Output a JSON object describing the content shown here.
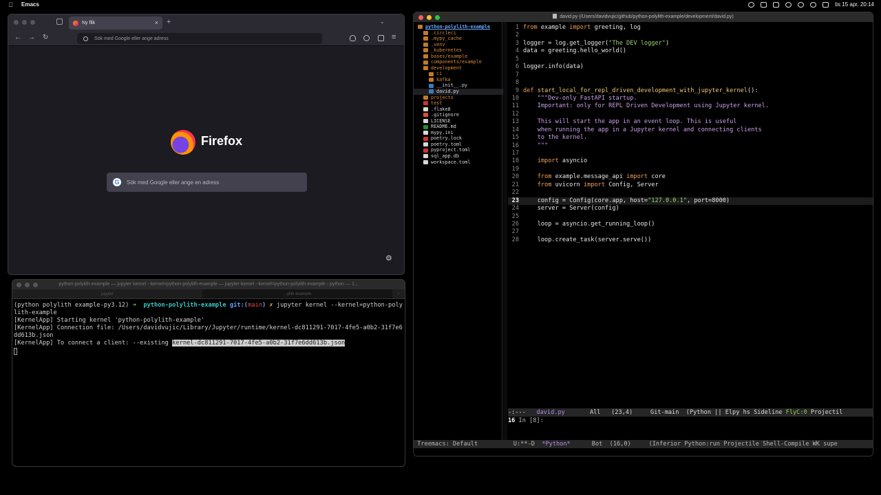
{
  "menubar": {
    "app_name": "Emacs",
    "datetime": "tis 15 apr. 20:14"
  },
  "firefox": {
    "tab_title": "Ny flik",
    "url_placeholder": "Sök med Google eller ange adress",
    "brand": "Firefox",
    "search_placeholder": "Sök med Google eller ange en adress"
  },
  "terminal": {
    "title": "python-polylith-example — jupyter kernel --kernel=python-polylith-example — jupyter-kernel --kernel=python-polylith-example › python — 1...",
    "tabs": [
      "jupyter",
      "...ylith-example"
    ],
    "prompt_env": "(python polylith example-py3.12)",
    "prompt_arrow": "➜",
    "prompt_dir": "python-polylith-example",
    "prompt_git_pre": "git:(",
    "prompt_branch": "main",
    "prompt_git_post": ")",
    "prompt_mark": "✗",
    "command": "jupyter kernel --kernel=python-polylith-example",
    "output_1": "[KernelApp] Starting kernel 'python-polylith-example'",
    "output_2": "[KernelApp] Connection file: /Users/davidvujic/Library/Jupyter/runtime/kernel-dc811291-7017-4fe5-a0b2-31f7e6dd613b.json",
    "output_3_prefix": "[KernelApp] To connect a client: --existing ",
    "output_3_selected": "kernel-dc811291-7017-4fe5-a0b2-31f7e6dd613b.json"
  },
  "emacs": {
    "title": "david.py (/Users/davidvujic/github/python-polylith-example/development/david.py)",
    "tree_root": "python-polylith-example",
    "tree": [
      {
        "name": ".circleci",
        "kind": "dir",
        "indent": 1
      },
      {
        "name": ".mypy_cache",
        "kind": "dir",
        "indent": 1
      },
      {
        "name": ".venv",
        "kind": "dir",
        "indent": 1
      },
      {
        "name": "_kubernetes",
        "kind": "dir",
        "indent": 1
      },
      {
        "name": "bases/example",
        "kind": "dir",
        "indent": 1
      },
      {
        "name": "components/example",
        "kind": "dir",
        "indent": 1
      },
      {
        "name": "development",
        "kind": "dir",
        "indent": 1
      },
      {
        "name": "ci",
        "kind": "dir",
        "indent": 2
      },
      {
        "name": "kafka",
        "kind": "dir",
        "indent": 2
      },
      {
        "name": "__init__.py",
        "kind": "py",
        "indent": 2
      },
      {
        "name": "david.py",
        "kind": "py",
        "indent": 2,
        "selected": true
      },
      {
        "name": "projects",
        "kind": "dir",
        "indent": 1
      },
      {
        "name": "test",
        "kind": "red-dir",
        "indent": 1
      },
      {
        "name": ".flake8",
        "kind": "file",
        "indent": 1
      },
      {
        "name": ".gitignore",
        "kind": "git",
        "indent": 1
      },
      {
        "name": "LICENSE",
        "kind": "file",
        "indent": 1
      },
      {
        "name": "README.md",
        "kind": "md",
        "indent": 1
      },
      {
        "name": "mypy.ini",
        "kind": "file",
        "indent": 1
      },
      {
        "name": "poetry.lock",
        "kind": "red",
        "indent": 1
      },
      {
        "name": "poetry.toml",
        "kind": "file",
        "indent": 1
      },
      {
        "name": "pyproject.toml",
        "kind": "red",
        "indent": 1
      },
      {
        "name": "sql_app.db",
        "kind": "file",
        "indent": 1
      },
      {
        "name": "workspace.toml",
        "kind": "file",
        "indent": 1
      }
    ],
    "code_lines": [
      [
        [
          "kw",
          "from"
        ],
        [
          "mod",
          " example "
        ],
        [
          "kw",
          "import"
        ],
        [
          "mod",
          " greeting, log"
        ]
      ],
      [],
      [
        [
          "mod",
          "logger = log.get_logger("
        ],
        [
          "str",
          "\"The DEV logger\""
        ],
        [
          "mod",
          ")"
        ]
      ],
      [
        [
          "mod",
          "data = greeting.hello_world()"
        ]
      ],
      [],
      [
        [
          "mod",
          "logger.info(data)"
        ]
      ],
      [],
      [],
      [
        [
          "kw",
          "def"
        ],
        [
          "mod",
          " "
        ],
        [
          "fn",
          "start_local_for_repl_driven_development_with_jupyter_kernel"
        ],
        [
          "mod",
          "():"
        ]
      ],
      [
        [
          "doc",
          "    \"\"\"Dev-only FastAPI startup."
        ]
      ],
      [
        [
          "doc",
          "    Important: only for REPL Driven Development using Jupyter kernel."
        ]
      ],
      [],
      [
        [
          "doc",
          "    This will start the app in an event loop. This is useful"
        ]
      ],
      [
        [
          "doc",
          "    when running the app in a Jupyter kernel and connecting clients"
        ]
      ],
      [
        [
          "doc",
          "    to the kernel."
        ]
      ],
      [
        [
          "doc",
          "    \"\"\""
        ]
      ],
      [],
      [
        [
          "kw",
          "    import"
        ],
        [
          "mod",
          " asyncio"
        ]
      ],
      [],
      [
        [
          "kw",
          "    from"
        ],
        [
          "mod",
          " example.message_api "
        ],
        [
          "kw",
          "import"
        ],
        [
          "mod",
          " core"
        ]
      ],
      [
        [
          "kw",
          "    from"
        ],
        [
          "mod",
          " uvicorn "
        ],
        [
          "kw",
          "import"
        ],
        [
          "mod",
          " Config, Server"
        ]
      ],
      [],
      [
        [
          "mod",
          "    config = Config(core.app, host="
        ],
        [
          "str",
          "\"127.0.0.1\""
        ],
        [
          "mod",
          ", port=8000)"
        ]
      ],
      [
        [
          "mod",
          "    server = Server(config)"
        ]
      ],
      [],
      [
        [
          "mod",
          "    loop = asyncio.get_running_loop()"
        ]
      ],
      [],
      [
        [
          "mod",
          "    loop.create_task(server.serve())"
        ]
      ]
    ],
    "current_line": 23,
    "modeline": {
      "state": "-:---",
      "buffer": "david.py",
      "position": "All",
      "cursor": "(23,4)",
      "vc": "Git-main",
      "modes_pre": "(Python || Elpy hs Sideline ",
      "flycheck": "FlyC:0",
      "modes_post": " Projectil"
    },
    "repl_line_number": "16",
    "repl_prompt": "In [8]:",
    "bottom_modeline": {
      "treemacs": "Treemacs: Default",
      "state": "U:**-D",
      "buffer": "*Python*",
      "position": "Bot",
      "cursor": "(16,0)",
      "modes": "(Inferior Python:run Projectile Shell-Compile WK supe"
    }
  }
}
